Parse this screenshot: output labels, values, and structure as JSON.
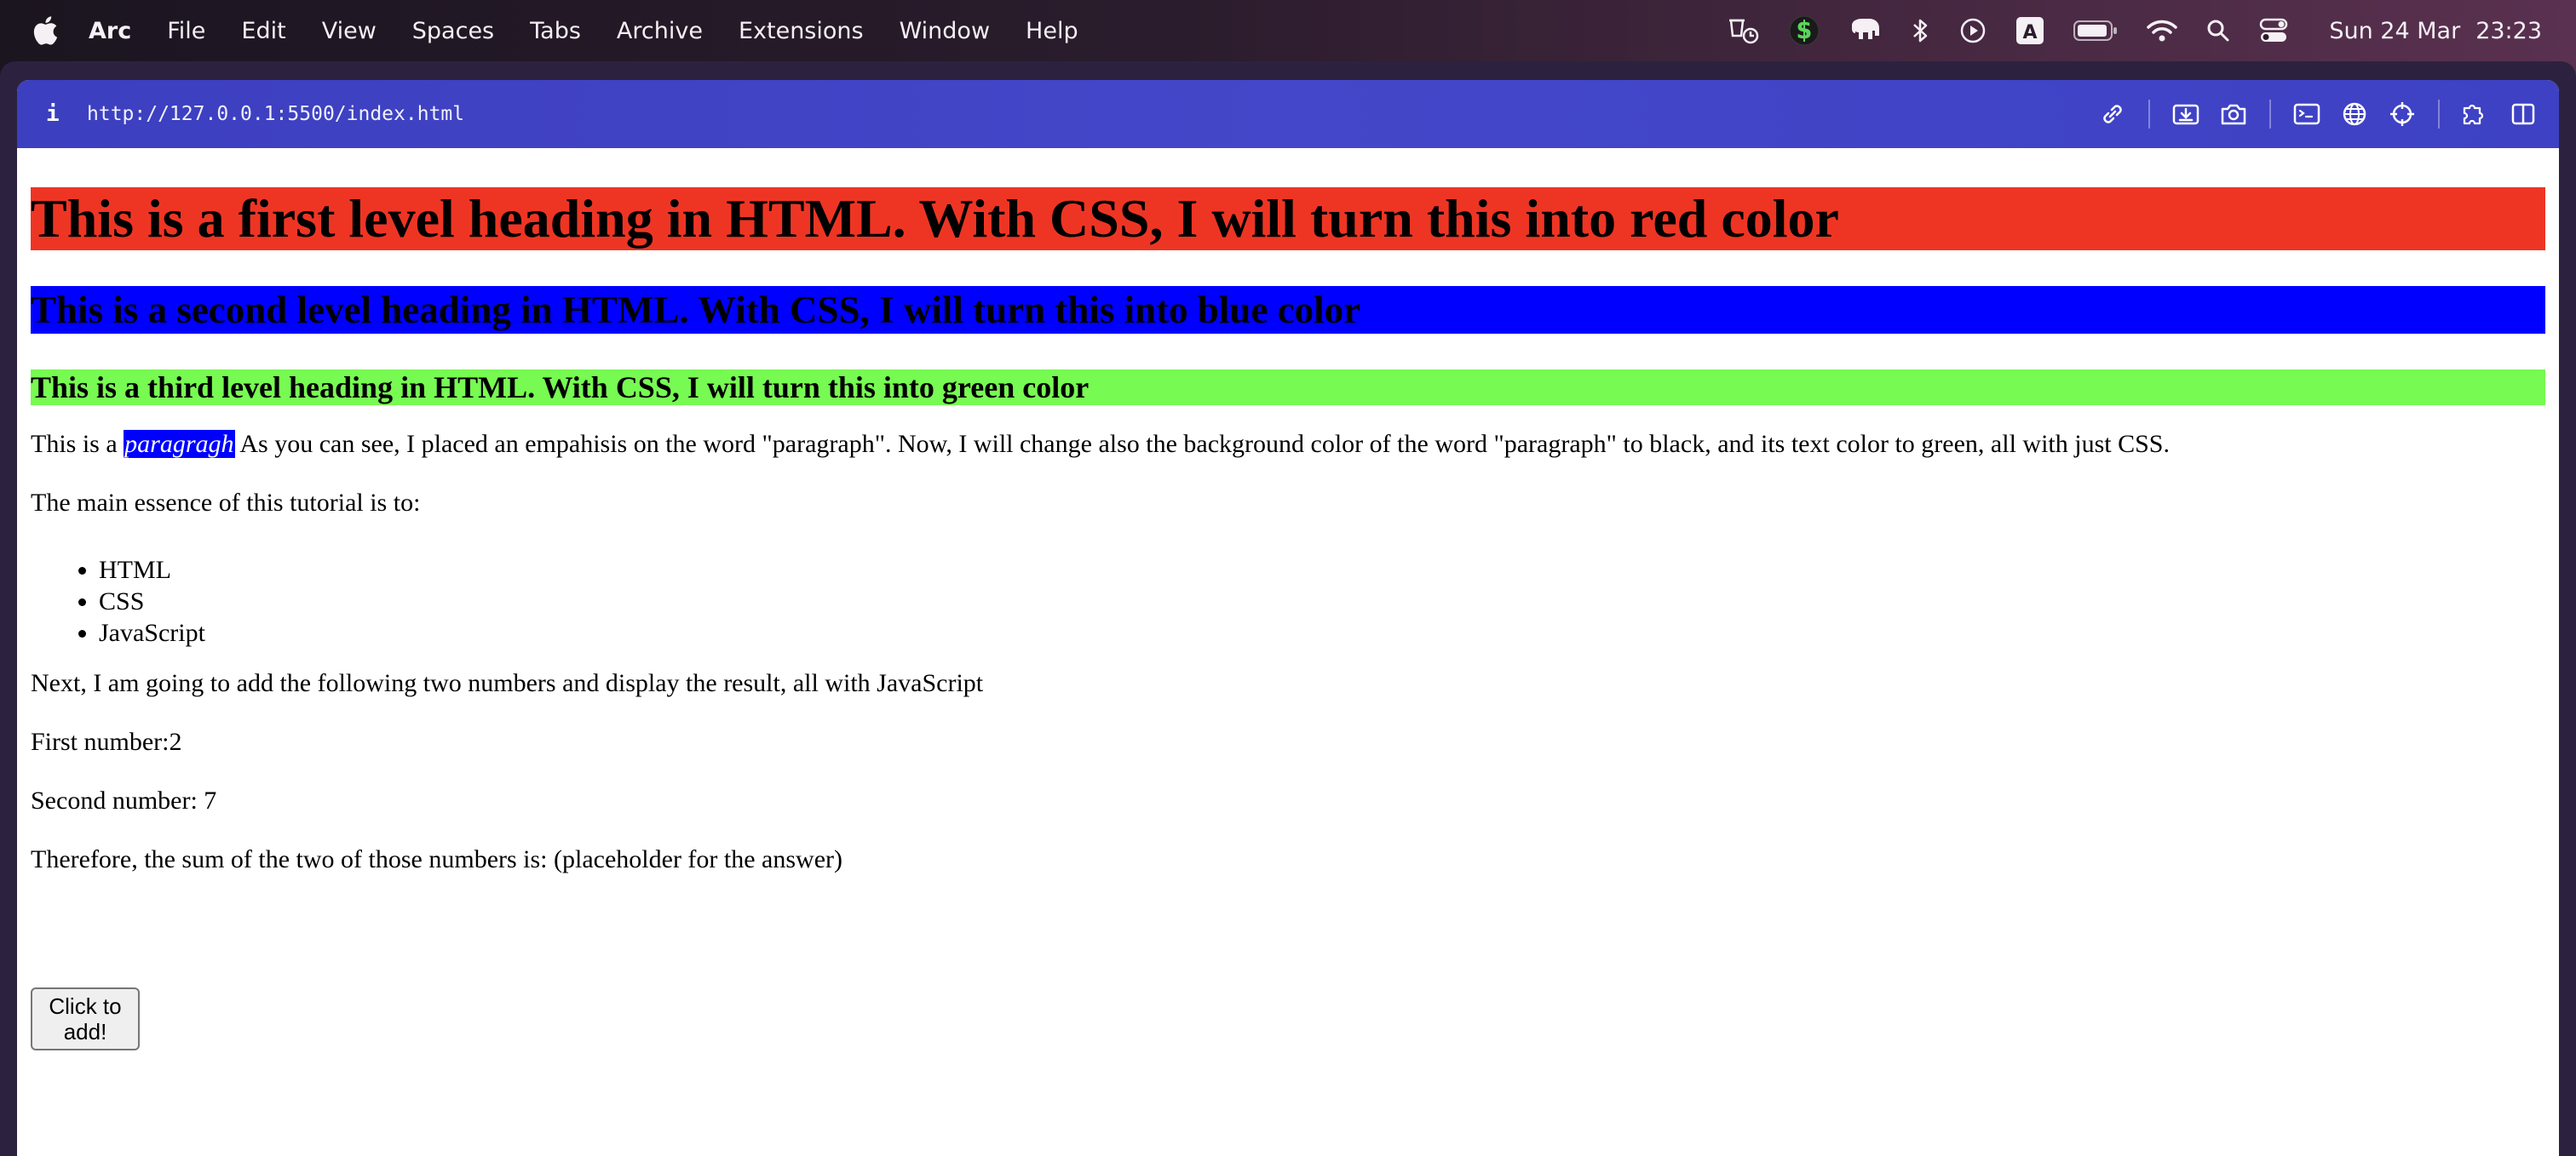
{
  "menubar": {
    "app_name": "Arc",
    "items": [
      "File",
      "Edit",
      "View",
      "Spaces",
      "Tabs",
      "Archive",
      "Extensions",
      "Window",
      "Help"
    ],
    "clock_date": "Sun 24 Mar",
    "clock_time": "23:23",
    "input_source": "A",
    "status_icons": [
      "focus-timer-icon",
      "dollar-app-icon",
      "elephant-icon",
      "bluetooth-icon",
      "play-icon",
      "input-source-icon",
      "battery-icon",
      "wifi-icon",
      "search-icon",
      "control-center-icon"
    ]
  },
  "browser": {
    "info_glyph": "i",
    "url": "http://127.0.0.1:5500/index.html",
    "toolbar_icons": [
      "link-icon",
      "download-icon",
      "camera-icon",
      "terminal-icon",
      "globe-icon",
      "crosshair-icon",
      "extension-icon",
      "sidebar-icon"
    ],
    "accent_color": "#4245c6"
  },
  "page": {
    "h1": "This is a first level heading in HTML. With CSS, I will turn this into red color",
    "h2": "This is a second level heading in HTML. With CSS, I will turn this into blue color",
    "h3": "This is a third level heading in HTML. With CSS, I will turn this into green color",
    "p1_before": "This is a ",
    "p1_emphasis": "paragragh",
    "p1_after": " As you can see, I placed an empahisis on the word \"paragraph\". Now, I will change also the background color of the word \"paragraph\" to black, and its text color to green, all with just CSS.",
    "p2": "The main essence of this tutorial is to:",
    "list": [
      "HTML",
      "CSS",
      "JavaScript"
    ],
    "p3": "Next, I am going to add the following two numbers and display the result, all with JavaScript",
    "first_number": "First number:2",
    "second_number": "Second number: 7",
    "sum_text": "Therefore, the sum of the two of those numbers is: (placeholder for the answer)",
    "button_label": "Click to add!",
    "colors": {
      "h1_bg": "#ee3524",
      "h2_bg": "#0000ff",
      "h3_bg": "#77fa52",
      "em_bg": "#0000ff"
    }
  }
}
